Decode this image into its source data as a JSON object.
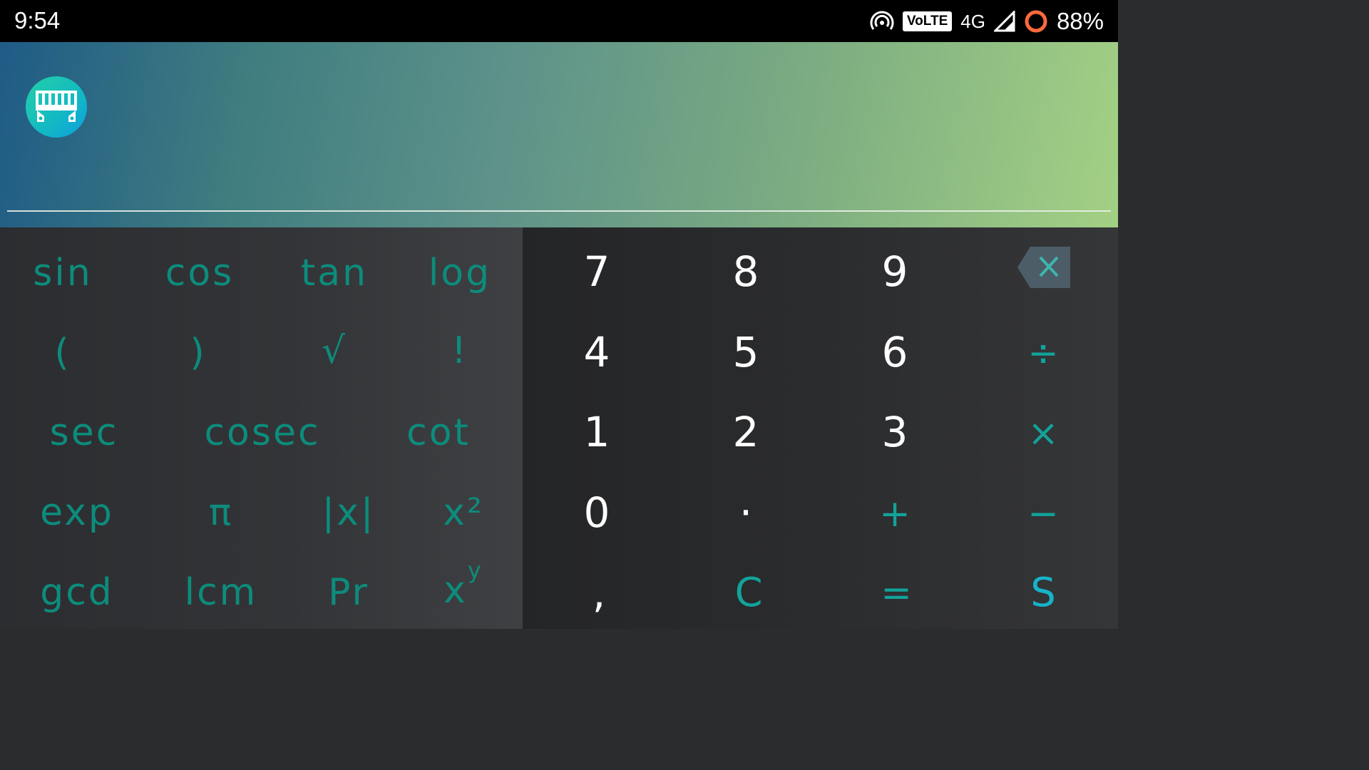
{
  "status_bar": {
    "time": "9:54",
    "volte": "VoLTE",
    "network": "4G",
    "battery": "88%",
    "icons": [
      "hotspot-icon",
      "signal-icon",
      "battery-icon"
    ]
  },
  "display": {
    "expression": "",
    "accent": "#0c8c7c"
  },
  "scientific_keys": {
    "sin": "sin",
    "cos": "cos",
    "tan": "tan",
    "log": "log",
    "lparen": "(",
    "rparen": ")",
    "sqrt": "√",
    "fact": "!",
    "sec": "sec",
    "cosec": "cosec",
    "cot": "cot",
    "exp": "exp",
    "pi": "π",
    "abs": "|x|",
    "square": "x²",
    "gcd": "gcd",
    "lcm": "lcm",
    "pr": "Pr",
    "power_base": "x",
    "power_exp": "y"
  },
  "number_keys": {
    "seven": "7",
    "eight": "8",
    "nine": "9",
    "four": "4",
    "five": "5",
    "six": "6",
    "divide": "÷",
    "one": "1",
    "two": "2",
    "three": "3",
    "multiply": "×",
    "zero": "0",
    "dot": "·",
    "plus": "+",
    "minus": "−",
    "comma": ",",
    "clear": "C",
    "equals": "=",
    "s": "S"
  }
}
